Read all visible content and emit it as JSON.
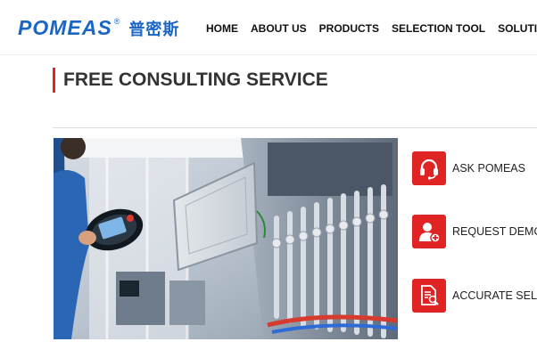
{
  "header": {
    "logo_text": "POMEAS",
    "logo_reg": "®",
    "logo_cn": "普密斯",
    "nav": [
      "HOME",
      "ABOUT US",
      "PRODUCTS",
      "SELECTION TOOL",
      "SOLUTIONS"
    ]
  },
  "section": {
    "title": "FREE CONSULTING SERVICE"
  },
  "hero": {
    "icon": "factory-automation-photo"
  },
  "services": [
    {
      "label": "ASK POMEAS",
      "icon": "headset-icon"
    },
    {
      "label": "REQUEST DEMO/",
      "icon": "add-user-icon"
    },
    {
      "label": "ACCURATE SELEC",
      "icon": "document-search-icon"
    }
  ],
  "colors": {
    "brand_blue": "#1a66c4",
    "accent_red": "#e02323"
  }
}
